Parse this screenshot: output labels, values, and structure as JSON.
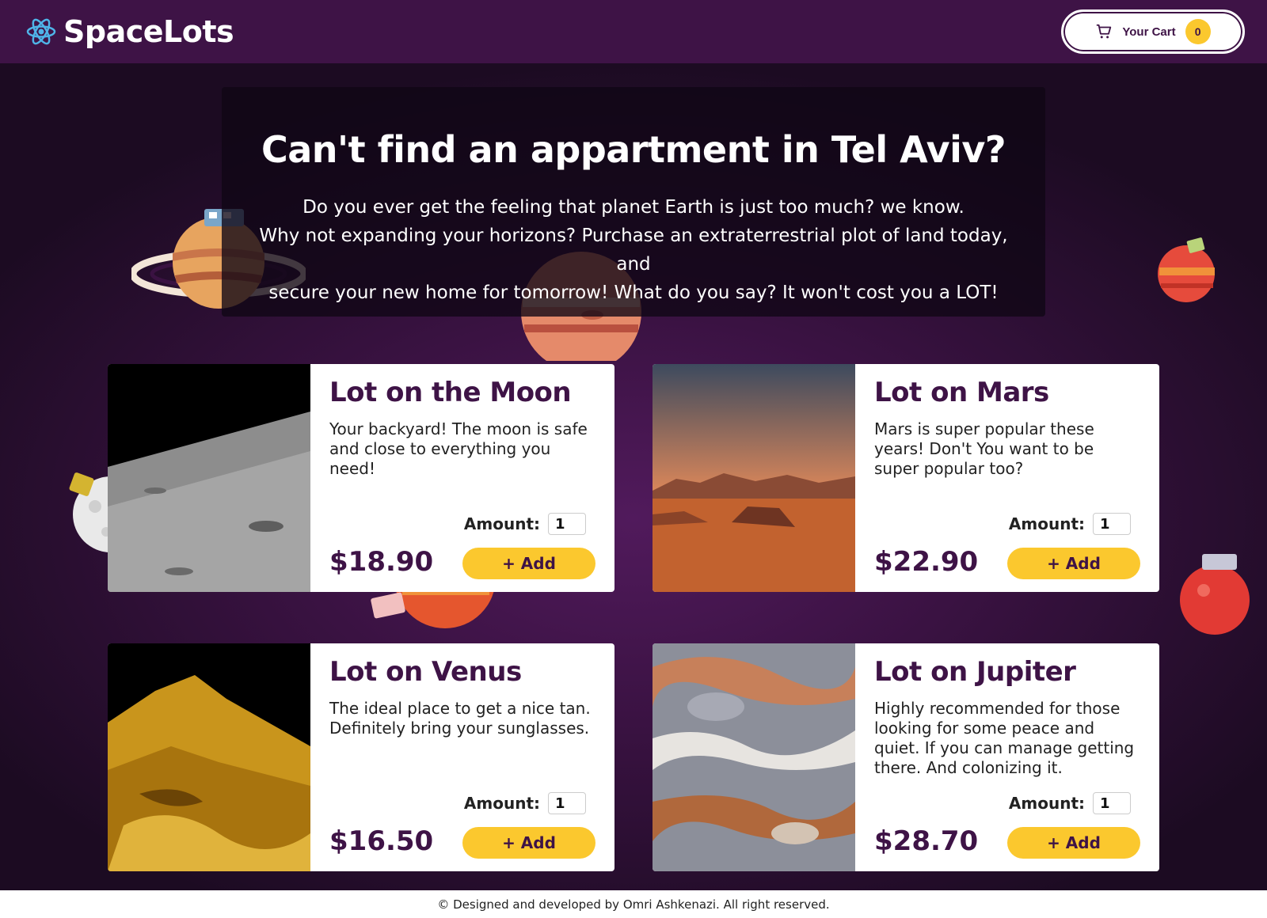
{
  "header": {
    "brand_name": "SpaceLots",
    "logo_icon": "atom-icon",
    "cart": {
      "label": "Your Cart",
      "count": "0",
      "icon": "cart-icon"
    }
  },
  "hero": {
    "title": "Can't find an appartment in Tel Aviv?",
    "lines": [
      "Do you ever get the feeling that planet Earth is just too much? we know.",
      "Why not expanding your horizons? Purchase an extraterrestrial plot of land today, and",
      "secure your new home for tomorrow! What do you say? It won't cost you a LOT!"
    ]
  },
  "products": [
    {
      "title": "Lot on the Moon",
      "description": "Your backyard! The moon is safe and close to everything you need!",
      "amount_label": "Amount:",
      "amount": "1",
      "price": "$18.90",
      "add_label": "+ Add",
      "image": "moon-surface-image"
    },
    {
      "title": "Lot on Mars",
      "description": "Mars is super popular these years! Don't You want to be super popular too?",
      "amount_label": "Amount:",
      "amount": "1",
      "price": "$22.90",
      "add_label": "+ Add",
      "image": "mars-desert-image"
    },
    {
      "title": "Lot on Venus",
      "description": "The ideal place to get a nice tan. Definitely bring your sunglasses.",
      "amount_label": "Amount:",
      "amount": "1",
      "price": "$16.50",
      "add_label": "+ Add",
      "image": "venus-surface-image"
    },
    {
      "title": "Lot on Jupiter",
      "description": "Highly recommended for those looking for some peace and quiet. If you can manage getting there. And colonizing it.",
      "amount_label": "Amount:",
      "amount": "1",
      "price": "$28.70",
      "add_label": "+ Add",
      "image": "jupiter-clouds-image"
    }
  ],
  "footer": {
    "text": "© Designed and developed by Omri Ashkenazi. All right reserved."
  },
  "colors": {
    "header_bg": "#3e1346",
    "accent_yellow": "#fbc82e",
    "title_purple": "#3e1346",
    "logo_blue": "#4fb4e8"
  }
}
